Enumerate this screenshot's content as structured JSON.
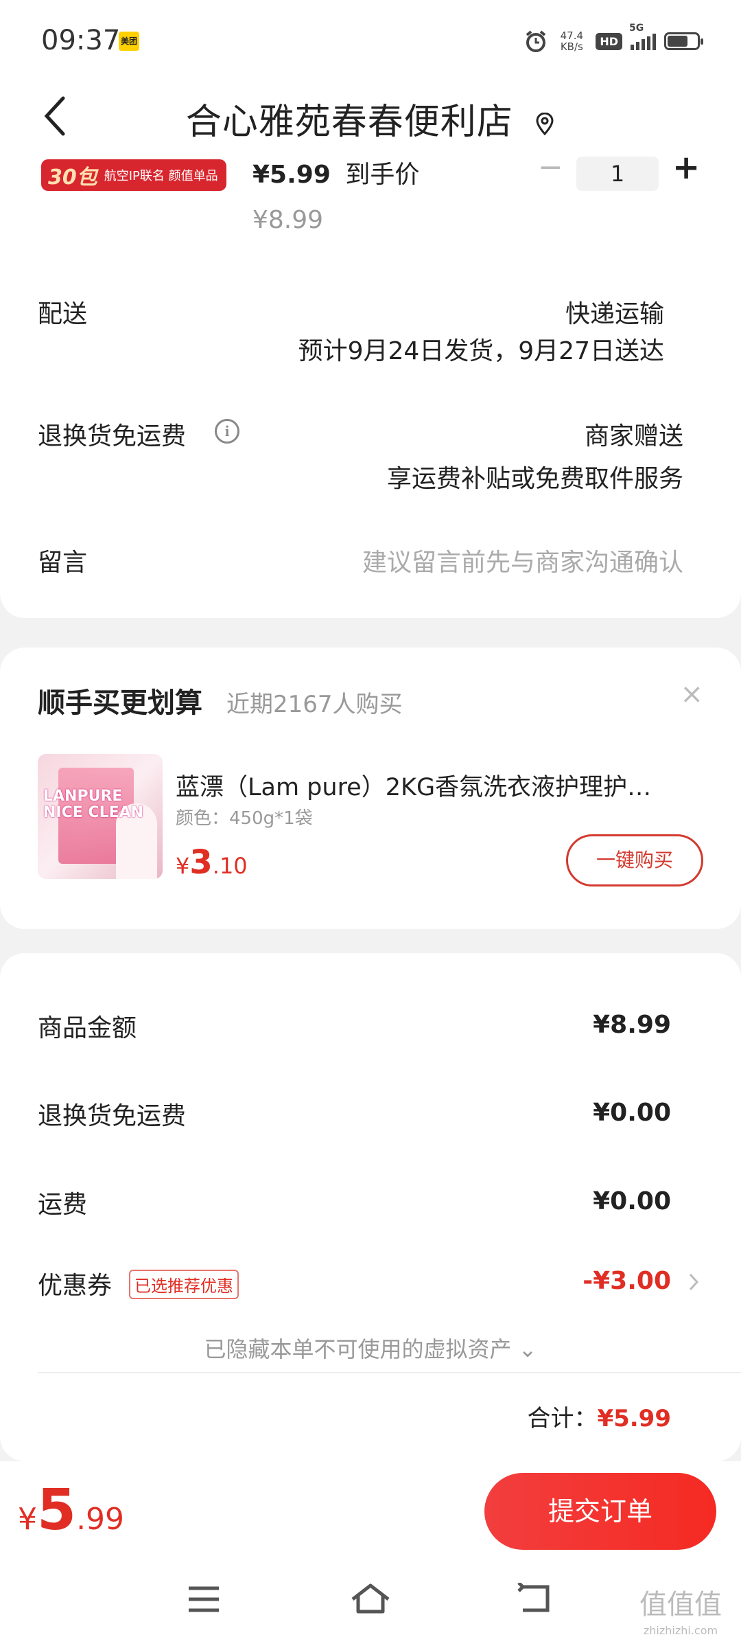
{
  "status_bar": {
    "time": "09:37",
    "app_badge": "美团",
    "net_speed_value": "47.4",
    "net_speed_unit": "KB/s",
    "hd": "HD",
    "network": "5G"
  },
  "header": {
    "back_icon": "chevron-left-icon",
    "title": "合心雅苑春春便利店",
    "location_icon": "location-pin-icon"
  },
  "product": {
    "badge_count": "30包",
    "badge_text": "航空IP联名 颜值单品",
    "final_price": "¥5.99",
    "final_price_label": "到手价",
    "original_price": "¥8.99",
    "quantity": "1",
    "minus": "−",
    "plus": "+"
  },
  "delivery": {
    "label": "配送",
    "method": "快递运输",
    "schedule": "预计9月24日发货，9月27日送达"
  },
  "return_shipping": {
    "label": "退换货免运费",
    "value": "商家赠送",
    "desc": "享运费补贴或免费取件服务"
  },
  "message": {
    "label": "留言",
    "placeholder": "建议留言前先与商家沟通确认"
  },
  "upsell": {
    "title": "顺手买更划算",
    "subtitle": "近期2167人购买",
    "close": "×",
    "product_name": "蓝漂（Lam pure）2KG香氛洗衣液护理护…",
    "spec": "颜色：450g*1袋",
    "price_symbol": "¥",
    "price_int": "3",
    "price_dec": ".10",
    "buy_label": "一键购买",
    "thumb_brand": "LANPURE NICE CLEAN"
  },
  "summary": {
    "goods_label": "商品金额",
    "goods_value": "¥8.99",
    "return_fee_label": "退换货免运费",
    "return_fee_value": "¥0.00",
    "shipping_label": "运费",
    "shipping_value": "¥0.00",
    "coupon_label": "优惠券",
    "coupon_tag": "已选推荐优惠",
    "coupon_value": "-¥3.00",
    "hidden_assets": "已隐藏本单不可使用的虚拟资产 ⌄",
    "total_label": "合计：",
    "total_value": "¥5.99"
  },
  "bottom": {
    "price_symbol": "¥",
    "price_int": "5",
    "price_dec": ".99",
    "submit_label": "提交订单"
  },
  "nav": {
    "menu": "☰",
    "home": "⌂",
    "back": "⮌"
  },
  "watermark": {
    "main": "值值值",
    "sub": "zhizhizhi.com"
  },
  "colors": {
    "accent_red": "#e02e24",
    "button_red": "#f23e3e"
  }
}
